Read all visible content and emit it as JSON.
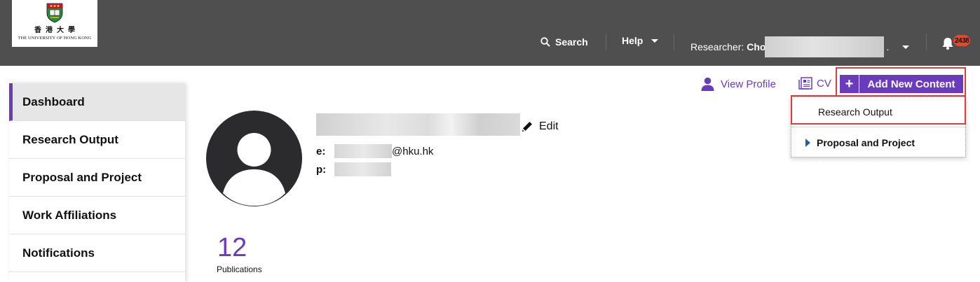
{
  "logo": {
    "chinese": "香港大學",
    "english": "THE UNIVERSITY OF HONG KONG"
  },
  "header": {
    "search_label": "Search",
    "help_label": "Help",
    "researcher_prefix": "Researcher:",
    "researcher_name_visible": "Cho",
    "researcher_name_tail": ".",
    "notification_count": "2438"
  },
  "sidebar": {
    "items": [
      {
        "label": "Dashboard",
        "active": true
      },
      {
        "label": "Research Output",
        "active": false
      },
      {
        "label": "Proposal and Project",
        "active": false
      },
      {
        "label": "Work Affiliations",
        "active": false
      },
      {
        "label": "Notifications",
        "active": false
      }
    ]
  },
  "actions": {
    "view_profile_label": "View Profile",
    "cv_label": "CV",
    "add_new_label": "Add New Content",
    "add_plus": "+"
  },
  "dropdown": {
    "item1": "Research Output",
    "item2": "Proposal and Project"
  },
  "profile": {
    "edit_label": "Edit",
    "email_label": "e:",
    "email_suffix": "@hku.hk",
    "phone_label": "p:"
  },
  "stats": {
    "publications_count": "12",
    "publications_label": "Publications"
  },
  "colors": {
    "topbar": "#4f4f4f",
    "accent": "#6b3bbd",
    "highlight": "#e03c3c",
    "badge": "#e8462a"
  }
}
